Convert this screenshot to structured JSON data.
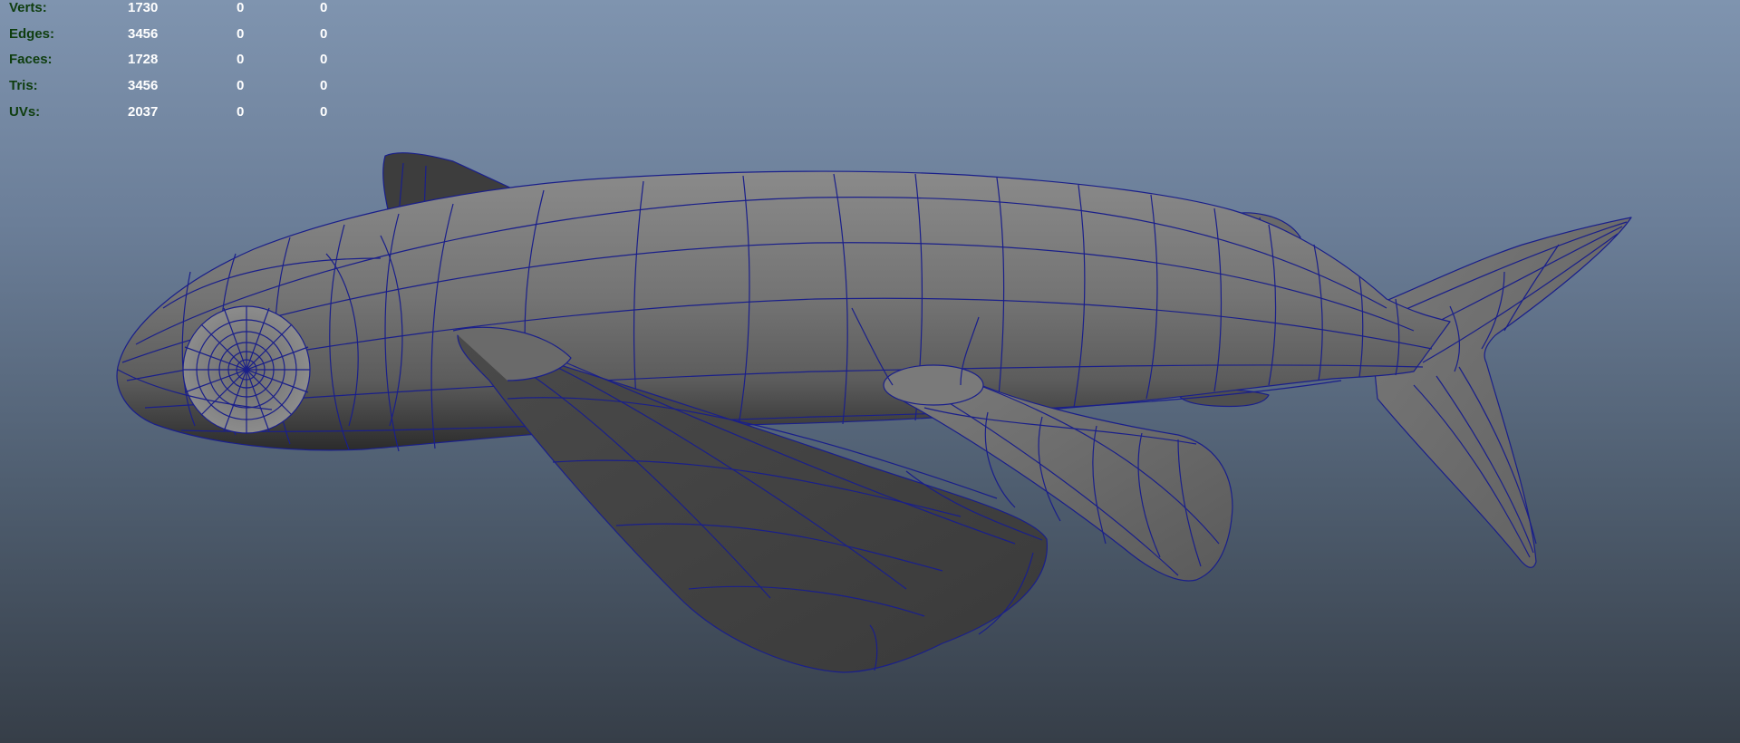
{
  "hud": {
    "rows": [
      {
        "label": "Verts:",
        "v1": "1730",
        "v2": "0",
        "v3": "0"
      },
      {
        "label": "Edges:",
        "v1": "3456",
        "v2": "0",
        "v3": "0"
      },
      {
        "label": "Faces:",
        "v1": "1728",
        "v2": "0",
        "v3": "0"
      },
      {
        "label": "Tris:",
        "v1": "3456",
        "v2": "0",
        "v3": "0"
      },
      {
        "label": "UVs:",
        "v1": "2037",
        "v2": "0",
        "v3": "0"
      }
    ]
  },
  "colors": {
    "label": "#0e3d0e",
    "value": "#ffffff",
    "wireframe": "#1a1f8a",
    "surface": "#6d6d6d",
    "surface_dark": "#3a3a3a"
  }
}
